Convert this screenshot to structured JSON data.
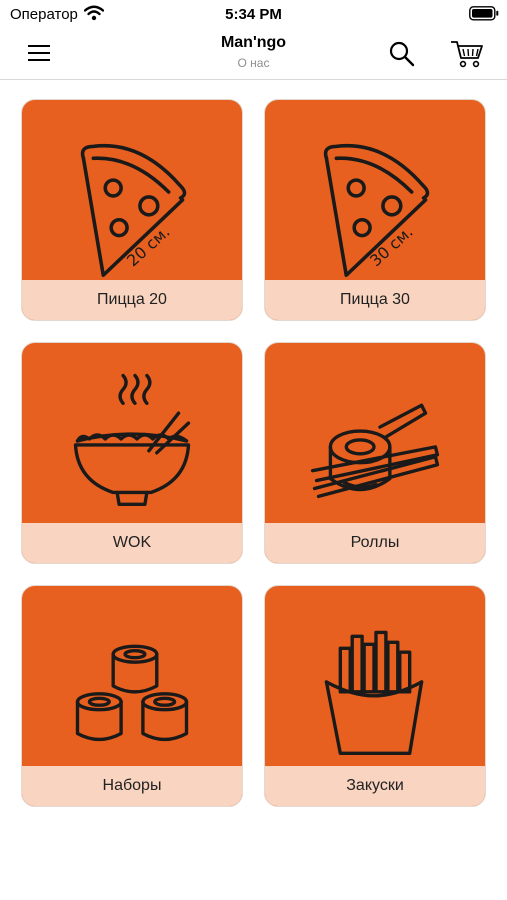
{
  "status_bar": {
    "carrier": "Оператор",
    "time": "5:34 PM"
  },
  "header": {
    "title": "Man'ngo",
    "subtitle": "О нас",
    "menu_icon": "hamburger-menu-icon",
    "search_icon": "search-icon",
    "cart_icon": "cart-icon"
  },
  "categories": [
    {
      "label": "Пицца 20",
      "icon": "pizza-slice-icon",
      "icon_text": "20 см."
    },
    {
      "label": "Пицца 30",
      "icon": "pizza-slice-icon",
      "icon_text": "30 см."
    },
    {
      "label": "WOK",
      "icon": "wok-bowl-icon"
    },
    {
      "label": "Роллы",
      "icon": "roll-chopsticks-icon"
    },
    {
      "label": "Наборы",
      "icon": "rolls-set-icon"
    },
    {
      "label": "Закуски",
      "icon": "fries-icon"
    }
  ],
  "colors": {
    "accent": "#e8601f",
    "label_band": "#f9d4c0",
    "icon_stroke": "#1a1a1a"
  }
}
